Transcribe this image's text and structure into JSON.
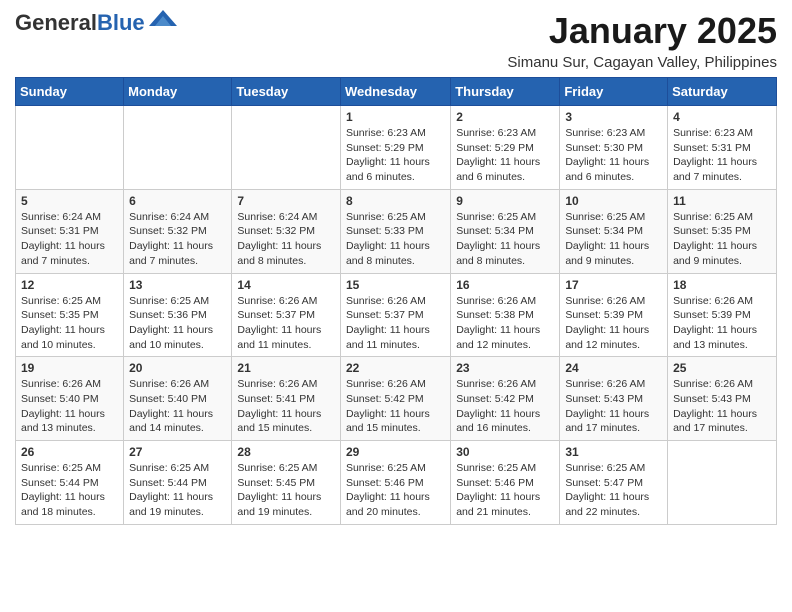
{
  "header": {
    "logo_line1": "General",
    "logo_line2": "Blue",
    "month_year": "January 2025",
    "location": "Simanu Sur, Cagayan Valley, Philippines"
  },
  "weekdays": [
    "Sunday",
    "Monday",
    "Tuesday",
    "Wednesday",
    "Thursday",
    "Friday",
    "Saturday"
  ],
  "weeks": [
    [
      {
        "day": "",
        "info": ""
      },
      {
        "day": "",
        "info": ""
      },
      {
        "day": "",
        "info": ""
      },
      {
        "day": "1",
        "info": "Sunrise: 6:23 AM\nSunset: 5:29 PM\nDaylight: 11 hours and 6 minutes."
      },
      {
        "day": "2",
        "info": "Sunrise: 6:23 AM\nSunset: 5:29 PM\nDaylight: 11 hours and 6 minutes."
      },
      {
        "day": "3",
        "info": "Sunrise: 6:23 AM\nSunset: 5:30 PM\nDaylight: 11 hours and 6 minutes."
      },
      {
        "day": "4",
        "info": "Sunrise: 6:23 AM\nSunset: 5:31 PM\nDaylight: 11 hours and 7 minutes."
      }
    ],
    [
      {
        "day": "5",
        "info": "Sunrise: 6:24 AM\nSunset: 5:31 PM\nDaylight: 11 hours and 7 minutes."
      },
      {
        "day": "6",
        "info": "Sunrise: 6:24 AM\nSunset: 5:32 PM\nDaylight: 11 hours and 7 minutes."
      },
      {
        "day": "7",
        "info": "Sunrise: 6:24 AM\nSunset: 5:32 PM\nDaylight: 11 hours and 8 minutes."
      },
      {
        "day": "8",
        "info": "Sunrise: 6:25 AM\nSunset: 5:33 PM\nDaylight: 11 hours and 8 minutes."
      },
      {
        "day": "9",
        "info": "Sunrise: 6:25 AM\nSunset: 5:34 PM\nDaylight: 11 hours and 8 minutes."
      },
      {
        "day": "10",
        "info": "Sunrise: 6:25 AM\nSunset: 5:34 PM\nDaylight: 11 hours and 9 minutes."
      },
      {
        "day": "11",
        "info": "Sunrise: 6:25 AM\nSunset: 5:35 PM\nDaylight: 11 hours and 9 minutes."
      }
    ],
    [
      {
        "day": "12",
        "info": "Sunrise: 6:25 AM\nSunset: 5:35 PM\nDaylight: 11 hours and 10 minutes."
      },
      {
        "day": "13",
        "info": "Sunrise: 6:25 AM\nSunset: 5:36 PM\nDaylight: 11 hours and 10 minutes."
      },
      {
        "day": "14",
        "info": "Sunrise: 6:26 AM\nSunset: 5:37 PM\nDaylight: 11 hours and 11 minutes."
      },
      {
        "day": "15",
        "info": "Sunrise: 6:26 AM\nSunset: 5:37 PM\nDaylight: 11 hours and 11 minutes."
      },
      {
        "day": "16",
        "info": "Sunrise: 6:26 AM\nSunset: 5:38 PM\nDaylight: 11 hours and 12 minutes."
      },
      {
        "day": "17",
        "info": "Sunrise: 6:26 AM\nSunset: 5:39 PM\nDaylight: 11 hours and 12 minutes."
      },
      {
        "day": "18",
        "info": "Sunrise: 6:26 AM\nSunset: 5:39 PM\nDaylight: 11 hours and 13 minutes."
      }
    ],
    [
      {
        "day": "19",
        "info": "Sunrise: 6:26 AM\nSunset: 5:40 PM\nDaylight: 11 hours and 13 minutes."
      },
      {
        "day": "20",
        "info": "Sunrise: 6:26 AM\nSunset: 5:40 PM\nDaylight: 11 hours and 14 minutes."
      },
      {
        "day": "21",
        "info": "Sunrise: 6:26 AM\nSunset: 5:41 PM\nDaylight: 11 hours and 15 minutes."
      },
      {
        "day": "22",
        "info": "Sunrise: 6:26 AM\nSunset: 5:42 PM\nDaylight: 11 hours and 15 minutes."
      },
      {
        "day": "23",
        "info": "Sunrise: 6:26 AM\nSunset: 5:42 PM\nDaylight: 11 hours and 16 minutes."
      },
      {
        "day": "24",
        "info": "Sunrise: 6:26 AM\nSunset: 5:43 PM\nDaylight: 11 hours and 17 minutes."
      },
      {
        "day": "25",
        "info": "Sunrise: 6:26 AM\nSunset: 5:43 PM\nDaylight: 11 hours and 17 minutes."
      }
    ],
    [
      {
        "day": "26",
        "info": "Sunrise: 6:25 AM\nSunset: 5:44 PM\nDaylight: 11 hours and 18 minutes."
      },
      {
        "day": "27",
        "info": "Sunrise: 6:25 AM\nSunset: 5:44 PM\nDaylight: 11 hours and 19 minutes."
      },
      {
        "day": "28",
        "info": "Sunrise: 6:25 AM\nSunset: 5:45 PM\nDaylight: 11 hours and 19 minutes."
      },
      {
        "day": "29",
        "info": "Sunrise: 6:25 AM\nSunset: 5:46 PM\nDaylight: 11 hours and 20 minutes."
      },
      {
        "day": "30",
        "info": "Sunrise: 6:25 AM\nSunset: 5:46 PM\nDaylight: 11 hours and 21 minutes."
      },
      {
        "day": "31",
        "info": "Sunrise: 6:25 AM\nSunset: 5:47 PM\nDaylight: 11 hours and 22 minutes."
      },
      {
        "day": "",
        "info": ""
      }
    ]
  ]
}
